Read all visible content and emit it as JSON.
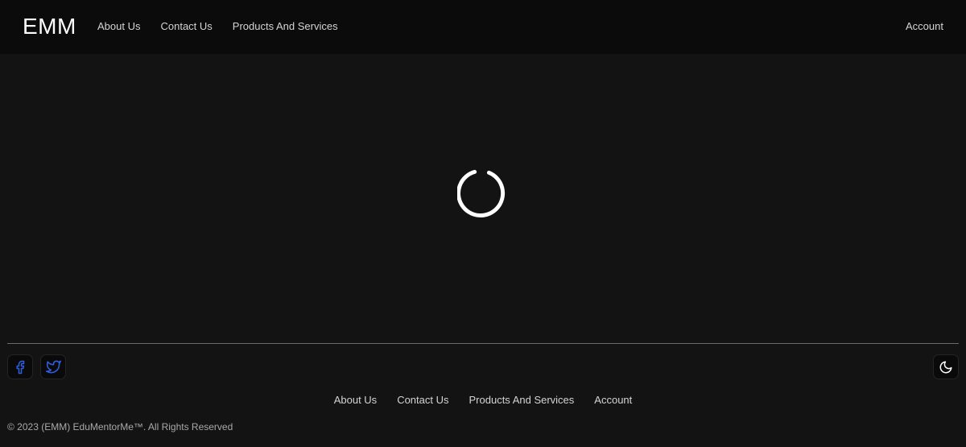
{
  "header": {
    "logo": "EMM",
    "nav": [
      {
        "label": "About Us"
      },
      {
        "label": "Contact Us"
      },
      {
        "label": "Products And Services"
      }
    ],
    "account_label": "Account"
  },
  "main": {
    "loading_icon": "loading-spinner-icon"
  },
  "footer": {
    "social": [
      {
        "icon": "facebook-icon",
        "color": "#2f5fe0"
      },
      {
        "icon": "twitter-icon",
        "color": "#2f5fe0"
      }
    ],
    "theme_toggle_icon": "moon-icon",
    "nav": [
      {
        "label": "About Us"
      },
      {
        "label": "Contact Us"
      },
      {
        "label": "Products And Services"
      },
      {
        "label": "Account"
      }
    ],
    "copyright": "© 2023 (EMM) EduMentorMe™. All Rights Reserved"
  },
  "colors": {
    "background": "#131313",
    "header_background": "#0b0b0b",
    "text": "#d4d4d4",
    "accent_icon": "#2f5fe0"
  }
}
